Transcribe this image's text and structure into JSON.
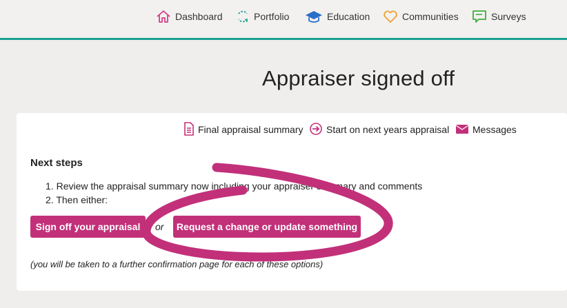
{
  "nav": {
    "items": [
      {
        "label": "Dashboard",
        "icon": "home-icon",
        "color": "#d43f8d"
      },
      {
        "label": "Portfolio",
        "icon": "refresh-icon",
        "color": "#1aa090"
      },
      {
        "label": "Education",
        "icon": "graduation-cap-icon",
        "color": "#2a6fc9"
      },
      {
        "label": "Communities",
        "icon": "heart-icon",
        "color": "#f0a030"
      },
      {
        "label": "Surveys",
        "icon": "chat-bubble-icon",
        "color": "#3cad3c"
      }
    ],
    "accent_color": "#1aa090"
  },
  "page": {
    "title": "Appraiser signed off"
  },
  "card": {
    "actions": [
      {
        "label": "Final appraisal summary",
        "icon": "document-icon"
      },
      {
        "label": "Start on next years appraisal",
        "icon": "arrow-circle-icon"
      },
      {
        "label": "Messages",
        "icon": "envelope-icon"
      }
    ],
    "heading": "Next steps",
    "steps": [
      {
        "number": "1.",
        "text": "Review the appraisal summary now including your appraiser summary and comments"
      },
      {
        "number": "2.",
        "text": "Then either:"
      }
    ],
    "sign_off_button": "Sign off your appraisal",
    "or_text": "or",
    "request_change_button": "Request a change or update something",
    "note": "(you will be taken to a further confirmation page for each of these options)",
    "button_color": "#c2307a"
  }
}
